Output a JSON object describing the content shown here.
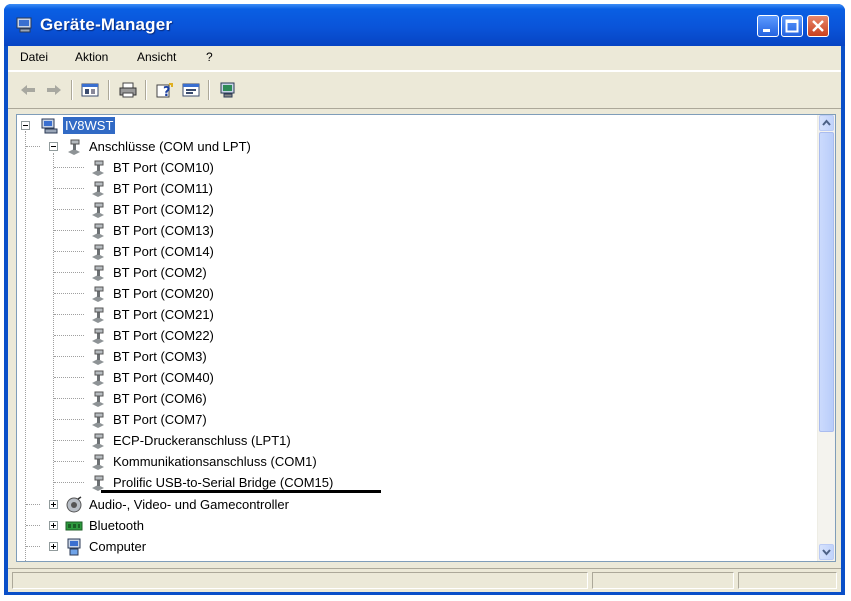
{
  "window": {
    "title": "Geräte-Manager",
    "title_icon": "device-manager-icon",
    "controls": [
      "minimize",
      "maximize",
      "close"
    ]
  },
  "menu": {
    "items": [
      "Datei",
      "Aktion",
      "Ansicht",
      "?"
    ]
  },
  "toolbar": {
    "buttons": [
      "back-icon",
      "forward-icon",
      "view-tree-icon",
      "print-icon",
      "help-icon",
      "properties-icon",
      "scan-hardware-icon"
    ]
  },
  "tree": {
    "root": {
      "label": "IV8WST",
      "selected": true,
      "icon": "computer-icon"
    },
    "groups": [
      {
        "label": "Anschlüsse (COM und LPT)",
        "icon": "port-icon",
        "expanded": true,
        "children": [
          "BT Port (COM10)",
          "BT Port (COM11)",
          "BT Port (COM12)",
          "BT Port (COM13)",
          "BT Port (COM14)",
          "BT Port (COM2)",
          "BT Port (COM20)",
          "BT Port (COM21)",
          "BT Port (COM22)",
          "BT Port (COM3)",
          "BT Port (COM40)",
          "BT Port (COM6)",
          "BT Port (COM7)",
          "ECP-Druckeranschluss (LPT1)",
          "Kommunikationsanschluss (COM1)",
          "Prolific USB-to-Serial Bridge (COM15)"
        ]
      },
      {
        "label": "Audio-, Video- und Gamecontroller",
        "icon": "audio-icon",
        "expanded": false
      },
      {
        "label": "Bluetooth",
        "icon": "bluetooth-icon",
        "expanded": false
      },
      {
        "label": "Computer",
        "icon": "computer-icon",
        "expanded": false
      }
    ]
  },
  "colors": {
    "titlebar": "#0A54D9",
    "selection": "#316AC5",
    "client": "#ECE9D8"
  }
}
